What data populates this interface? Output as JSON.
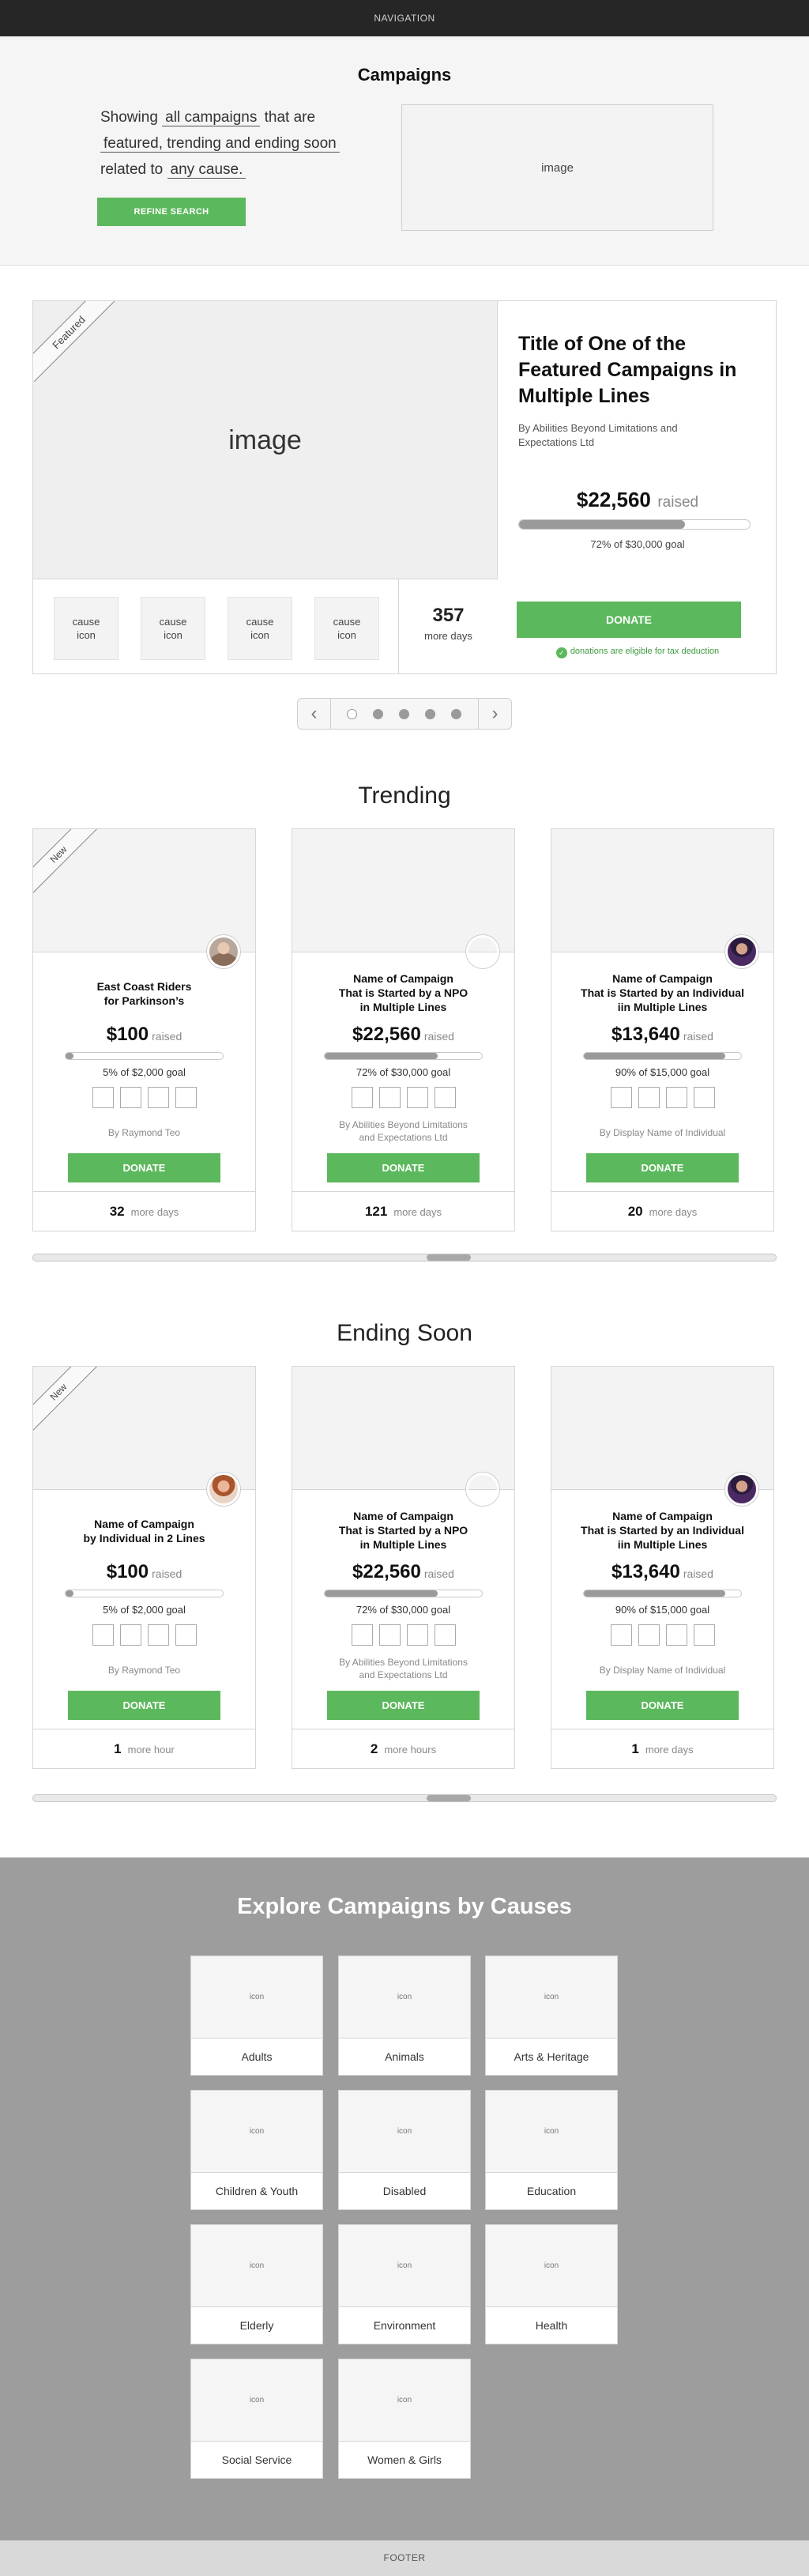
{
  "nav": {
    "label": "NAVIGATION"
  },
  "header": {
    "title": "Campaigns",
    "text_prefix": "Showing",
    "filter_link": "all campaigns",
    "text_mid": "that are",
    "sort_link": "featured, trending and ending soon",
    "text_related": "related to",
    "cause_link": "any cause.",
    "refine_button": "REFINE SEARCH",
    "image_placeholder": "image"
  },
  "featured": {
    "ribbon": "Featured",
    "image_placeholder": "image",
    "cause_icons": [
      "cause\nicon",
      "cause\nicon",
      "cause\nicon",
      "cause\nicon"
    ],
    "cause_icon_label_1": "cause",
    "cause_icon_label_2": "icon",
    "days_number": "357",
    "days_label": "more days",
    "title": "Title of One of the Featured Campaigns in Multiple Lines",
    "organization": "By Abilities Beyond Limitations and Expectations Ltd",
    "amount": "$22,560",
    "raised_label": "raised",
    "progress": 0.72,
    "goal_text": "72% of $30,000 goal",
    "donate_button": "DONATE",
    "tax_note": "donations are eligible for tax deduction"
  },
  "carousel": {
    "prev_icon": "‹",
    "next_icon": "›",
    "dot_count": 5,
    "active_dot": 0
  },
  "trending": {
    "title": "Trending",
    "cards": [
      {
        "ribbon": "New",
        "title_line1": "East Coast Riders",
        "title_line2": "for Parkinson’s",
        "title_line3": "",
        "amount": "$100",
        "raised_label": "raised",
        "progress": 0.05,
        "goal": "5% of $2,000 goal",
        "org_line1": "By Raymond Teo",
        "org_line2": "",
        "donate": "DONATE",
        "days": "32",
        "days_label": "more days"
      },
      {
        "ribbon": "",
        "title_line1": "Name of Campaign",
        "title_line2": "That is Started by a NPO",
        "title_line3": "in Multiple Lines",
        "amount": "$22,560",
        "raised_label": "raised",
        "progress": 0.72,
        "goal": "72% of $30,000 goal",
        "org_line1": "By Abilities Beyond Limitations",
        "org_line2": "and Expectations Ltd",
        "donate": "DONATE",
        "days": "121",
        "days_label": "more days"
      },
      {
        "ribbon": "",
        "title_line1": "Name of Campaign",
        "title_line2": "That is Started by an Individual",
        "title_line3": "iin Multiple Lines",
        "amount": "$13,640",
        "raised_label": "raised",
        "progress": 0.9,
        "goal": "90% of $15,000 goal",
        "org_line1": "By  Display Name of Individual",
        "org_line2": "",
        "donate": "DONATE",
        "days": "20",
        "days_label": "more days"
      }
    ]
  },
  "ending": {
    "title": "Ending Soon",
    "cards": [
      {
        "ribbon": "New",
        "title_line1": "Name of Campaign",
        "title_line2": "by Individual in 2 Lines",
        "title_line3": "",
        "amount": "$100",
        "raised_label": "raised",
        "progress": 0.05,
        "goal": "5% of $2,000 goal",
        "org_line1": "By Raymond Teo",
        "org_line2": "",
        "donate": "DONATE",
        "days": "1",
        "days_label": "more hour"
      },
      {
        "ribbon": "",
        "title_line1": "Name of Campaign",
        "title_line2": "That is Started by a NPO",
        "title_line3": "in Multiple Lines",
        "amount": "$22,560",
        "raised_label": "raised",
        "progress": 0.72,
        "goal": "72% of $30,000 goal",
        "org_line1": "By Abilities Beyond Limitations",
        "org_line2": "and Expectations Ltd",
        "donate": "DONATE",
        "days": "2",
        "days_label": "more hours"
      },
      {
        "ribbon": "",
        "title_line1": "Name of Campaign",
        "title_line2": "That is Started by an Individual",
        "title_line3": "iin Multiple Lines",
        "amount": "$13,640",
        "raised_label": "raised",
        "progress": 0.9,
        "goal": "90% of $15,000 goal",
        "org_line1": "By  Display Name of Individual",
        "org_line2": "",
        "donate": "DONATE",
        "days": "1",
        "days_label": "more days"
      }
    ]
  },
  "causes": {
    "title": "Explore Campaigns by Causes",
    "icon_placeholder": "icon",
    "items": [
      "Adults",
      "Animals",
      "Arts & Heritage",
      "Children & Youth",
      "Disabled",
      "Education",
      "Elderly",
      "Environment",
      "Health",
      "Social Service",
      "Women & Girls"
    ]
  },
  "footer": {
    "label": "FOOTER"
  },
  "colors": {
    "accent": "#5cb85c",
    "nav_bg": "#262626",
    "causes_bg": "#9d9d9d"
  }
}
